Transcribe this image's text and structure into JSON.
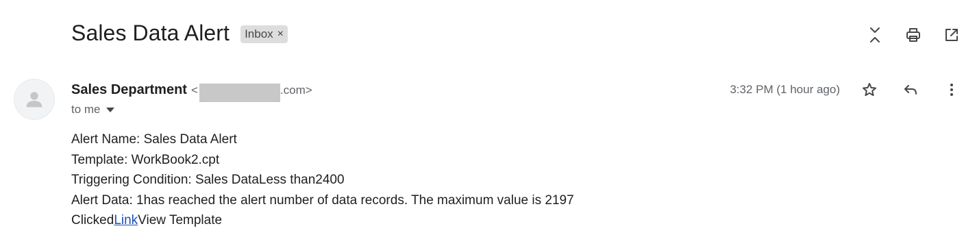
{
  "header": {
    "subject": "Sales Data Alert",
    "label": "Inbox",
    "label_close": "×",
    "actions": [
      {
        "name": "expand-collapse-icon"
      },
      {
        "name": "print-icon"
      },
      {
        "name": "open-new-window-icon"
      }
    ]
  },
  "message": {
    "sender_name": "Sales Department",
    "sender_email_prefix": "<",
    "sender_email_suffix": ".com>",
    "to": "to me",
    "timestamp": "3:32 PM (1 hour ago)",
    "body": {
      "line1": "Alert Name: Sales Data Alert",
      "line2": "Template: WorkBook2.cpt",
      "line3": "Triggering Condition: Sales DataLess than2400",
      "line4": "Alert Data: 1has reached the alert number of data records. The maximum value is 2197",
      "line5_prefix": "Clicked",
      "line5_link": "Link",
      "line5_suffix": "View Template"
    }
  },
  "colors": {
    "link": "#1a4fb7",
    "chip_bg": "#dddddd",
    "secondary_text": "#5f6368"
  }
}
